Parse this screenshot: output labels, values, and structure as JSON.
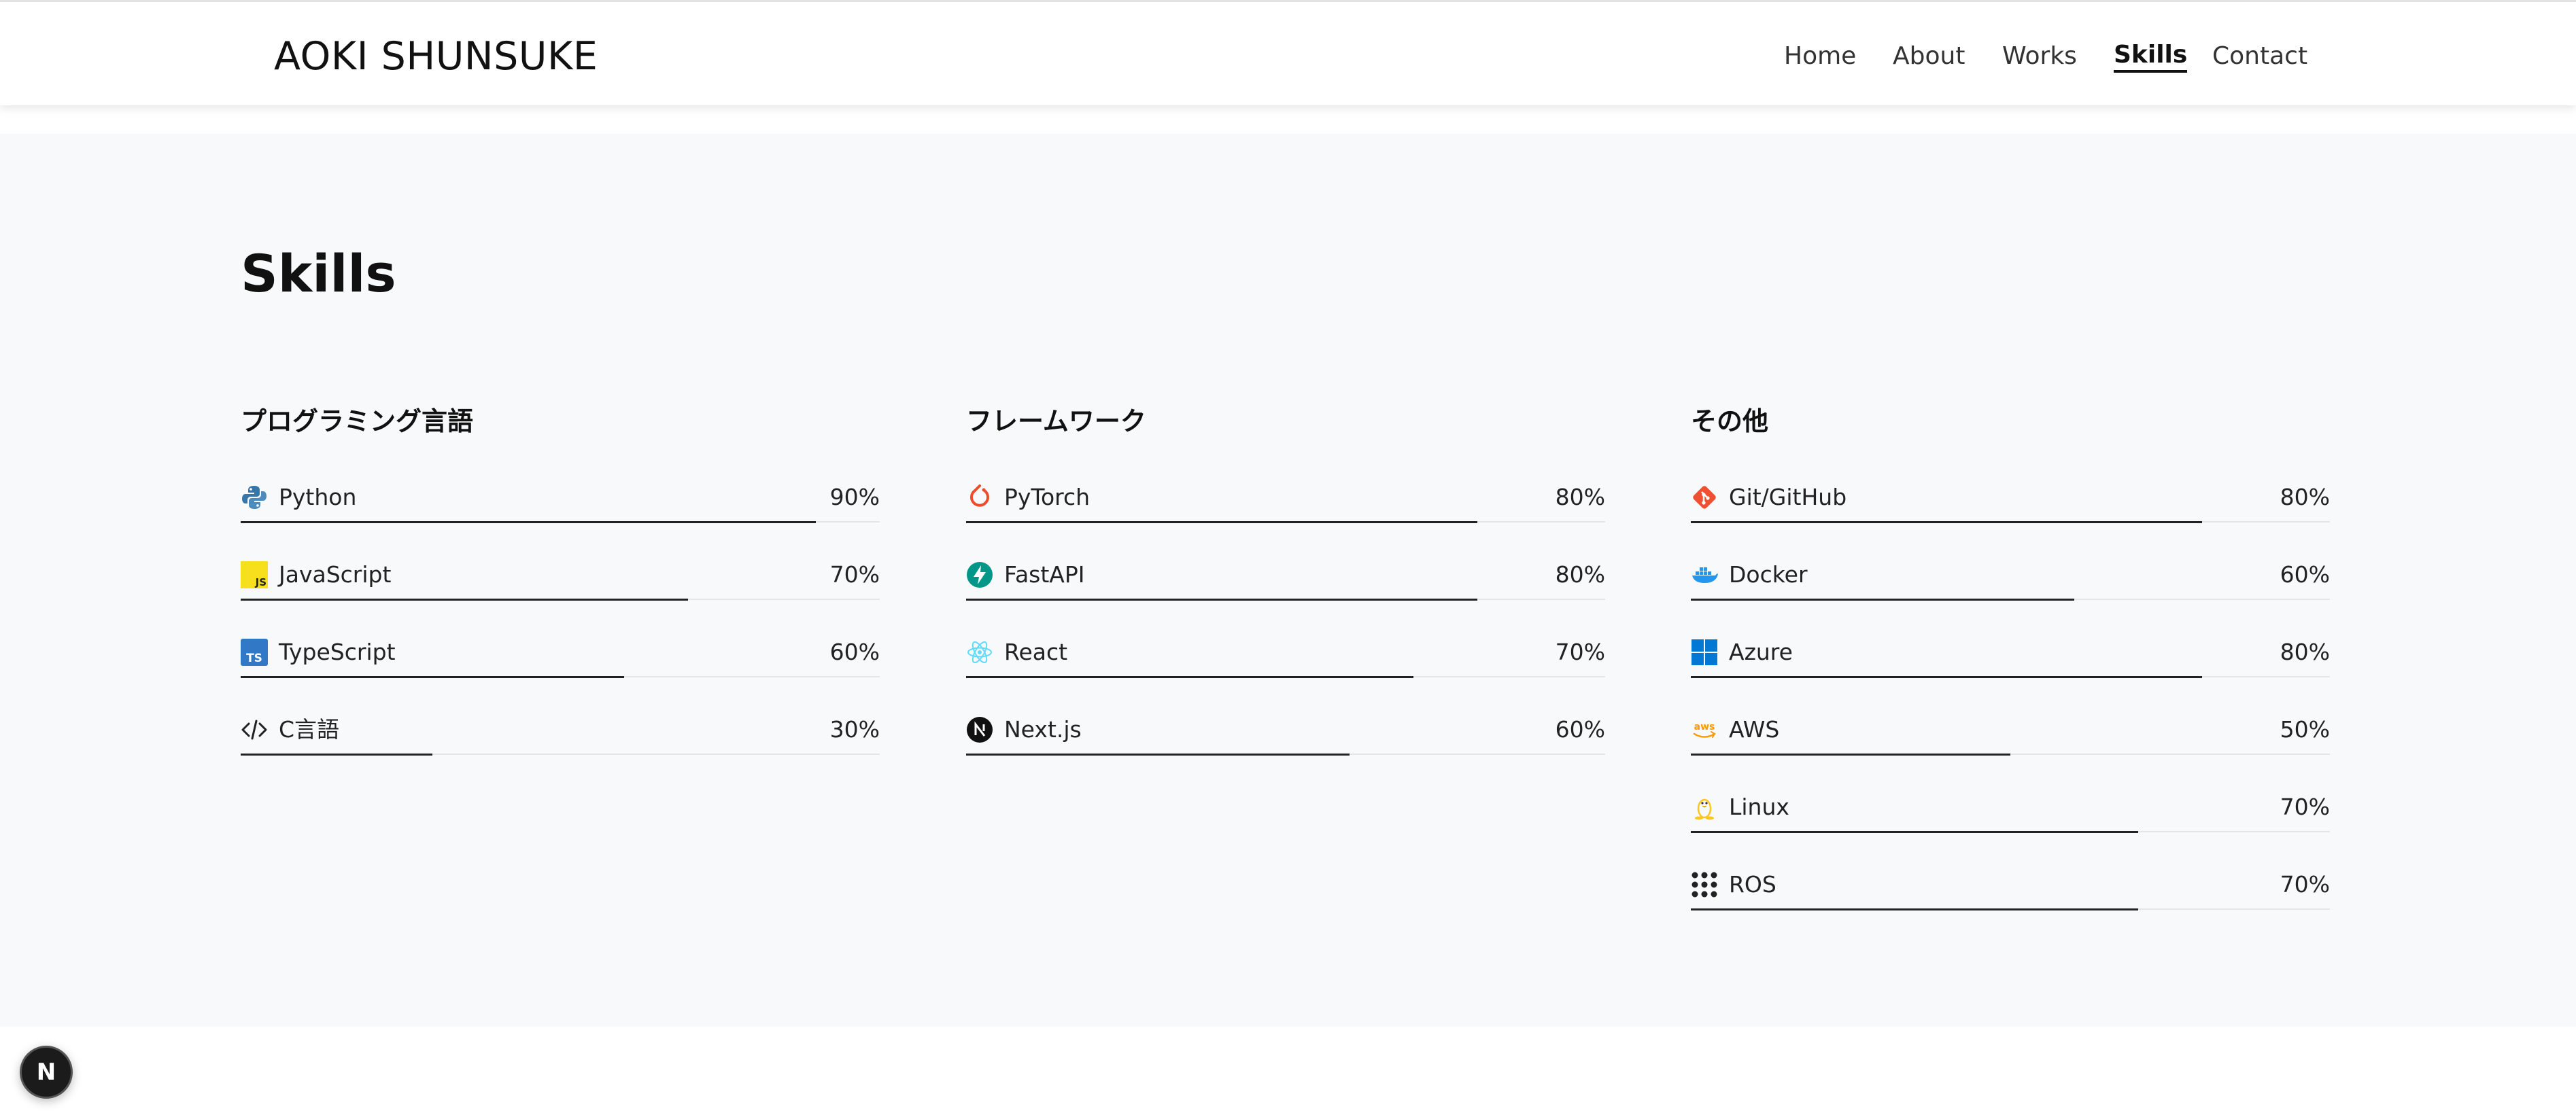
{
  "header": {
    "brand": "AOKI SHUNSUKE",
    "nav": [
      {
        "label": "Home",
        "active": false
      },
      {
        "label": "About",
        "active": false
      },
      {
        "label": "Works",
        "active": false
      },
      {
        "label": "Skills",
        "active": true
      },
      {
        "label": "Contact",
        "active": false
      }
    ]
  },
  "main": {
    "title": "Skills",
    "categories": [
      {
        "title": "プログラミング言語",
        "skills": [
          {
            "name": "Python",
            "percent": "90%",
            "level": 0.9,
            "icon": "python-icon"
          },
          {
            "name": "JavaScript",
            "percent": "70%",
            "level": 0.7,
            "icon": "javascript-icon"
          },
          {
            "name": "TypeScript",
            "percent": "60%",
            "level": 0.6,
            "icon": "typescript-icon"
          },
          {
            "name": "C言語",
            "percent": "30%",
            "level": 0.3,
            "icon": "code-icon"
          }
        ]
      },
      {
        "title": "フレームワーク",
        "skills": [
          {
            "name": "PyTorch",
            "percent": "80%",
            "level": 0.8,
            "icon": "pytorch-icon"
          },
          {
            "name": "FastAPI",
            "percent": "80%",
            "level": 0.8,
            "icon": "fastapi-icon"
          },
          {
            "name": "React",
            "percent": "70%",
            "level": 0.7,
            "icon": "react-icon"
          },
          {
            "name": "Next.js",
            "percent": "60%",
            "level": 0.6,
            "icon": "nextjs-icon"
          }
        ]
      },
      {
        "title": "その他",
        "skills": [
          {
            "name": "Git/GitHub",
            "percent": "80%",
            "level": 0.8,
            "icon": "git-icon"
          },
          {
            "name": "Docker",
            "percent": "60%",
            "level": 0.6,
            "icon": "docker-icon"
          },
          {
            "name": "Azure",
            "percent": "80%",
            "level": 0.8,
            "icon": "azure-icon"
          },
          {
            "name": "AWS",
            "percent": "50%",
            "level": 0.5,
            "icon": "aws-icon"
          },
          {
            "name": "Linux",
            "percent": "70%",
            "level": 0.7,
            "icon": "linux-icon"
          },
          {
            "name": "ROS",
            "percent": "70%",
            "level": 0.7,
            "icon": "ros-icon"
          }
        ]
      }
    ]
  },
  "colors": {
    "bar": "#222222",
    "track": "#e4e5e7",
    "section_bg": "#f8f9fa",
    "python": "#3776ab",
    "javascript": "#f7df1e",
    "typescript": "#3178c6",
    "pytorch": "#ee4c2c",
    "fastapi": "#009688",
    "react": "#61dafb",
    "git": "#f05032",
    "docker": "#2496ed",
    "azure": "#0078d4",
    "aws": "#ff9900",
    "linux": "#fcc624"
  },
  "badge": {
    "label": "N"
  }
}
